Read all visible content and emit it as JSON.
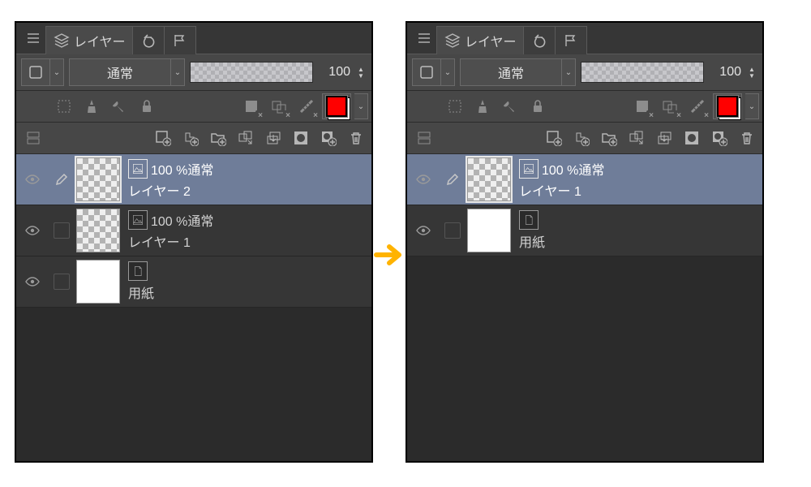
{
  "tabs": {
    "label_layers": "レイヤー"
  },
  "opts": {
    "blend_mode": "通常",
    "opacity_text": "100"
  },
  "left": {
    "layers": [
      {
        "status": "100 %通常",
        "name": "レイヤー 2",
        "selected": true,
        "thumb": "checker",
        "type": "raster"
      },
      {
        "status": "100 %通常",
        "name": "レイヤー 1",
        "selected": false,
        "thumb": "checker",
        "type": "raster"
      },
      {
        "status": "",
        "name": "用紙",
        "selected": false,
        "thumb": "white",
        "type": "paper"
      }
    ]
  },
  "right": {
    "layers": [
      {
        "status": "100 %通常",
        "name": "レイヤー 1",
        "selected": true,
        "thumb": "checker",
        "type": "raster"
      },
      {
        "status": "",
        "name": "用紙",
        "selected": false,
        "thumb": "white",
        "type": "paper"
      }
    ]
  }
}
